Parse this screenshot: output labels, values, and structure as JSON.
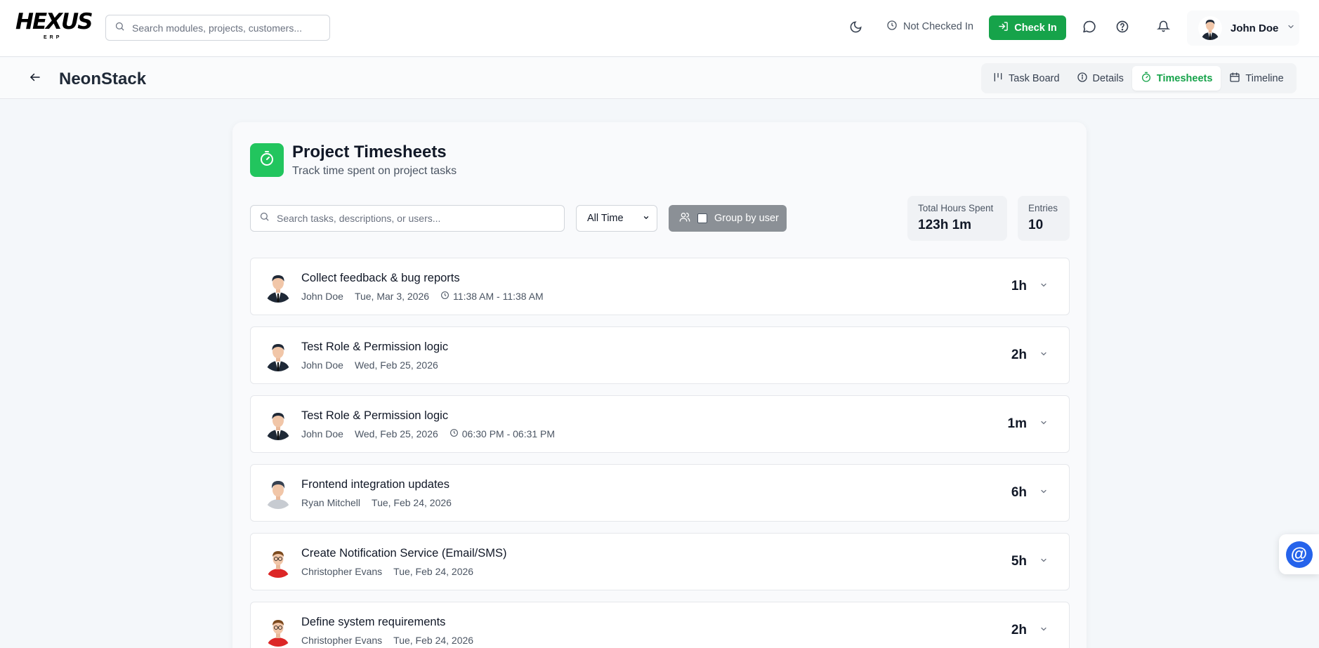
{
  "brand": {
    "logo_main": "HEXUS",
    "logo_sub": "ERP"
  },
  "header": {
    "search_placeholder": "Search modules, projects, customers...",
    "status_text": "Not Checked In",
    "checkin_label": "Check In",
    "user_name": "John Doe"
  },
  "project": {
    "name": "NeonStack",
    "tabs": [
      {
        "label": "Task Board",
        "active": false
      },
      {
        "label": "Details",
        "active": false
      },
      {
        "label": "Timesheets",
        "active": true
      },
      {
        "label": "Timeline",
        "active": false
      }
    ]
  },
  "timesheets": {
    "title": "Project Timesheets",
    "subtitle": "Track time spent on project tasks",
    "search_placeholder": "Search tasks, descriptions, or users...",
    "range_value": "All Time",
    "group_label": "Group by user",
    "group_checked": false,
    "total_label": "Total Hours Spent",
    "total_value": "123h 1m",
    "entries_label": "Entries",
    "entries_value": "10"
  },
  "entries": [
    {
      "title": "Collect feedback & bug reports",
      "user": "John Doe",
      "date": "Tue, Mar 3, 2026",
      "time": "11:38 AM - 11:38 AM",
      "hours": "1h",
      "avatar": "suit"
    },
    {
      "title": "Test Role & Permission logic",
      "user": "John Doe",
      "date": "Wed, Feb 25, 2026",
      "time": "",
      "hours": "2h",
      "avatar": "suit"
    },
    {
      "title": "Test Role & Permission logic",
      "user": "John Doe",
      "date": "Wed, Feb 25, 2026",
      "time": "06:30 PM - 06:31 PM",
      "hours": "1m",
      "avatar": "suit"
    },
    {
      "title": "Frontend integration updates",
      "user": "Ryan Mitchell",
      "date": "Tue, Feb 24, 2026",
      "time": "",
      "hours": "6h",
      "avatar": "gray"
    },
    {
      "title": "Create Notification Service (Email/SMS)",
      "user": "Christopher Evans",
      "date": "Tue, Feb 24, 2026",
      "time": "",
      "hours": "5h",
      "avatar": "red"
    },
    {
      "title": "Define system requirements",
      "user": "Christopher Evans",
      "date": "Tue, Feb 24, 2026",
      "time": "",
      "hours": "2h",
      "avatar": "red"
    }
  ],
  "colors": {
    "accent": "#16a34a",
    "icon_bg": "#22c55e",
    "float_btn": "#2563eb",
    "group_btn": "#8b9096"
  },
  "icons": {
    "theme": "moon-icon",
    "status": "clock-icon",
    "checkin": "login-icon",
    "chat": "chat-bubble-icon",
    "help": "help-circle-icon",
    "notifications": "bell-icon",
    "mention": "at-sign-icon"
  }
}
